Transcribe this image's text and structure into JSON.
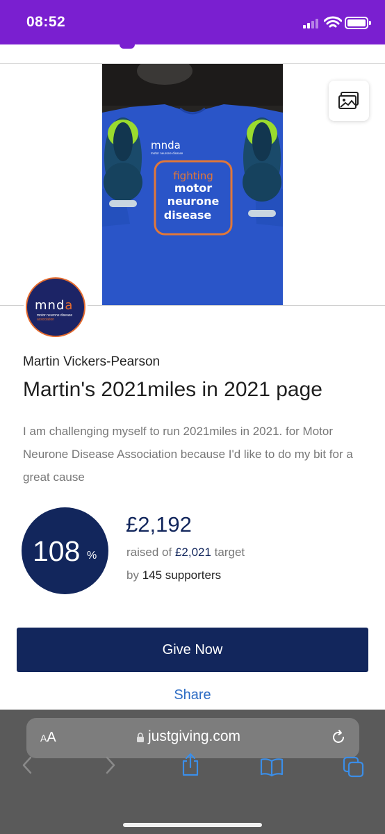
{
  "status_bar": {
    "time": "08:52"
  },
  "fundraiser": {
    "owner_name": "Martin Vickers-Pearson",
    "page_title": "Martin's 2021miles in 2021 page",
    "description": "I am challenging myself to run 2021miles in 2021. for Motor Neurone Disease Association because I'd like to do my bit for a great cause"
  },
  "charity_logo": {
    "wordmark_m": "mnd",
    "wordmark_a": "a",
    "line1": "motor neurone disease",
    "line2": "association"
  },
  "tshirt_print": {
    "brand": "mnda",
    "brand_sub": "motor neurone disease",
    "line1": "fighting",
    "line2": "motor",
    "line3": "neurone",
    "line4": "disease"
  },
  "progress": {
    "percent": "108",
    "percent_sign": "%",
    "percent_value": 108,
    "raised_amount": "£2,192",
    "raised_of_label": "raised of",
    "target_amount": "£2,021",
    "target_label": "target",
    "by_label": "by",
    "supporters": "145 supporters"
  },
  "actions": {
    "give_now": "Give Now",
    "share": "Share"
  },
  "browser": {
    "aa_label_small": "A",
    "aa_label_large": "A",
    "url": "justgiving.com"
  },
  "colors": {
    "status_bar": "#7a1fd0",
    "brand_navy": "#12265c",
    "link_blue": "#2d6cc4",
    "charity_orange": "#e46b2e",
    "shirt_blue": "#2a55c8"
  },
  "icons": [
    "gallery-icon",
    "lock-icon",
    "reload-icon",
    "back-icon",
    "forward-icon",
    "share-sheet-icon",
    "bookmarks-icon",
    "tabs-icon",
    "signal-icon",
    "wifi-icon",
    "battery-icon"
  ]
}
